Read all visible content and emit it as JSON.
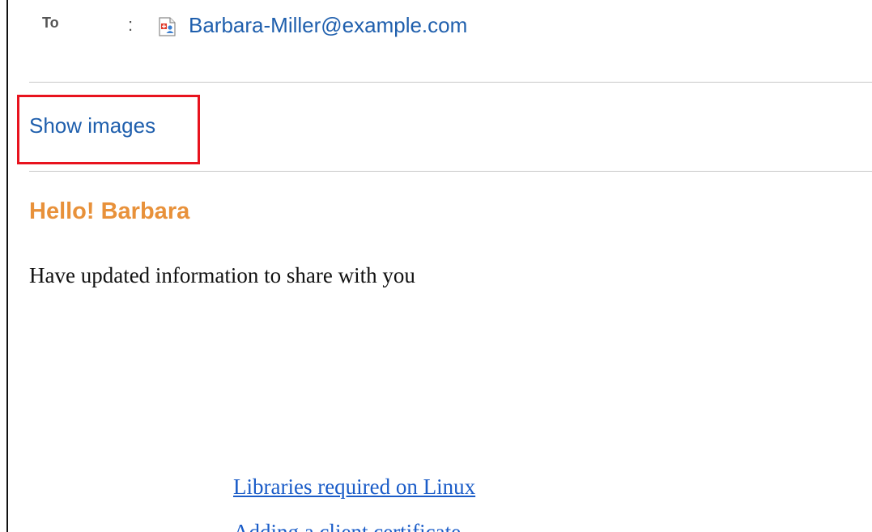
{
  "header": {
    "to_label": "To",
    "separator": ":",
    "recipient_icon": "contact-card-icon",
    "recipient": "Barbara-Miller@example.com"
  },
  "actions": {
    "show_images": "Show images"
  },
  "message": {
    "greeting": "Hello! Barbara",
    "body": "Have updated information to share with you",
    "links": [
      "Libraries required on Linux",
      "Adding a client certificate"
    ]
  },
  "colors": {
    "link": "#1f5fad",
    "greeting": "#e8913a",
    "highlight": "#e8131e"
  }
}
